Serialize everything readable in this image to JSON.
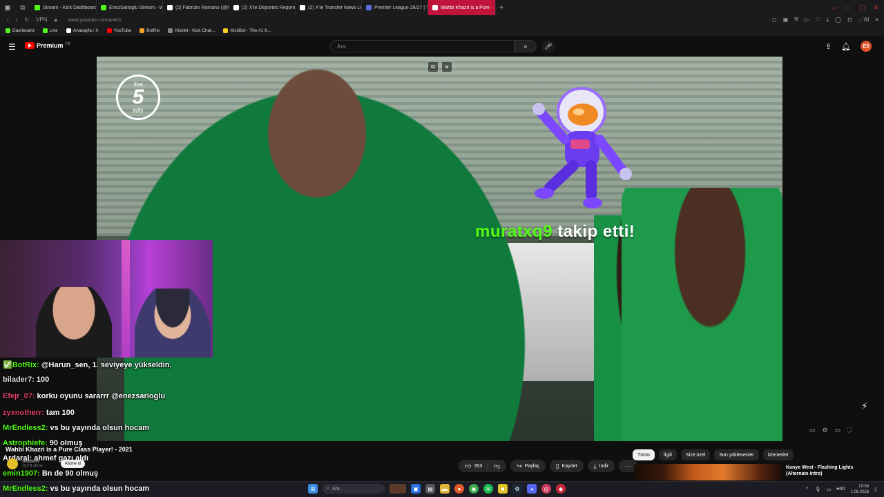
{
  "browser": {
    "tabs": [
      {
        "label": "Stream - Kick Dashboard",
        "color": "#53fc18"
      },
      {
        "label": "EnezSarioglu Stream - We",
        "color": "#53fc18"
      },
      {
        "label": "(2) Fabrizio Romano (@Fa",
        "color": "#ffffff"
      },
      {
        "label": "(2) X'te Deportes Reporte",
        "color": "#ffffff"
      },
      {
        "label": "(2) X'te Transfer News Liv",
        "color": "#ffffff"
      },
      {
        "label": "Premier League 26/27 | Tr",
        "color": "#5b6ee1"
      }
    ],
    "active_tab": "Wahbi Khazri is a Pure",
    "url": "www.youtube.com/watch",
    "bookmarks": [
      {
        "label": "Dashboard",
        "color": "#53fc18"
      },
      {
        "label": "Live",
        "color": "#53fc18"
      },
      {
        "label": "Anasayfa / X",
        "color": "#ffffff"
      },
      {
        "label": "YouTube",
        "color": "#ff0000"
      },
      {
        "label": "BotRix",
        "color": "#f5a623"
      },
      {
        "label": "Kicklet - Kick Chat...",
        "color": "#888888"
      },
      {
        "label": "KickBot - The #1 K...",
        "color": "#f5d223"
      }
    ]
  },
  "youtube": {
    "logo_text": "Premium",
    "logo_sup": "TR",
    "search_placeholder": "Ara",
    "avatar_initials": "ES"
  },
  "video": {
    "logo_number": "5",
    "logo_top": "ilva",
    "logo_bottom": "kills",
    "follow_user": "muratxq9",
    "follow_action": "takip etti!"
  },
  "chat": [
    {
      "user": "✅BotRix:",
      "color": "#53fc18",
      "msg": "@Harun_sen, 1. seviyeye yükseldin."
    },
    {
      "user": "bilader7:",
      "color": "#dddddd",
      "msg": "100"
    },
    {
      "user": "Efejr_07:",
      "color": "#e0406a",
      "msg": "korku oyunu sararrr @enezsarioglu"
    },
    {
      "user": "zyxnotherr:",
      "color": "#e0406a",
      "msg": "tam 100"
    },
    {
      "user": "MrEndless2:",
      "color": "#53fc18",
      "msg": "vs bu yayında olsun hocam"
    },
    {
      "user": "Astrophiefe:",
      "color": "#53fc18",
      "msg": "90 olmuş"
    },
    {
      "user": "Ardaral:",
      "color": "#ffffff",
      "msg": "ahmef gazı aldı"
    },
    {
      "user": "emin1907:",
      "color": "#53fc18",
      "msg": "Bn de 90 olmuş"
    }
  ],
  "taskbar_chat": {
    "user": "MrEndless2:",
    "msg": "vs bu yayında olsun hocam"
  },
  "below": {
    "title": "Wahbi Khazri is a Pure Class Player! - 2021",
    "channel": "silvaskills",
    "subs": "19,5 B abone",
    "subscribe": "Abone ol",
    "likes": "353",
    "share": "Paylaş",
    "save": "Kaydet",
    "download": "İndir",
    "chips": [
      "Tümü",
      "İlgili",
      "Size özel",
      "Son yüklenenler",
      "İzlenenler"
    ],
    "rec_title": "Kanye West - Flashing Lights (Alternate Intro)"
  },
  "taskbar": {
    "search": "Ara",
    "time": "19:58",
    "date": "1.08.2026",
    "lang": "40"
  }
}
